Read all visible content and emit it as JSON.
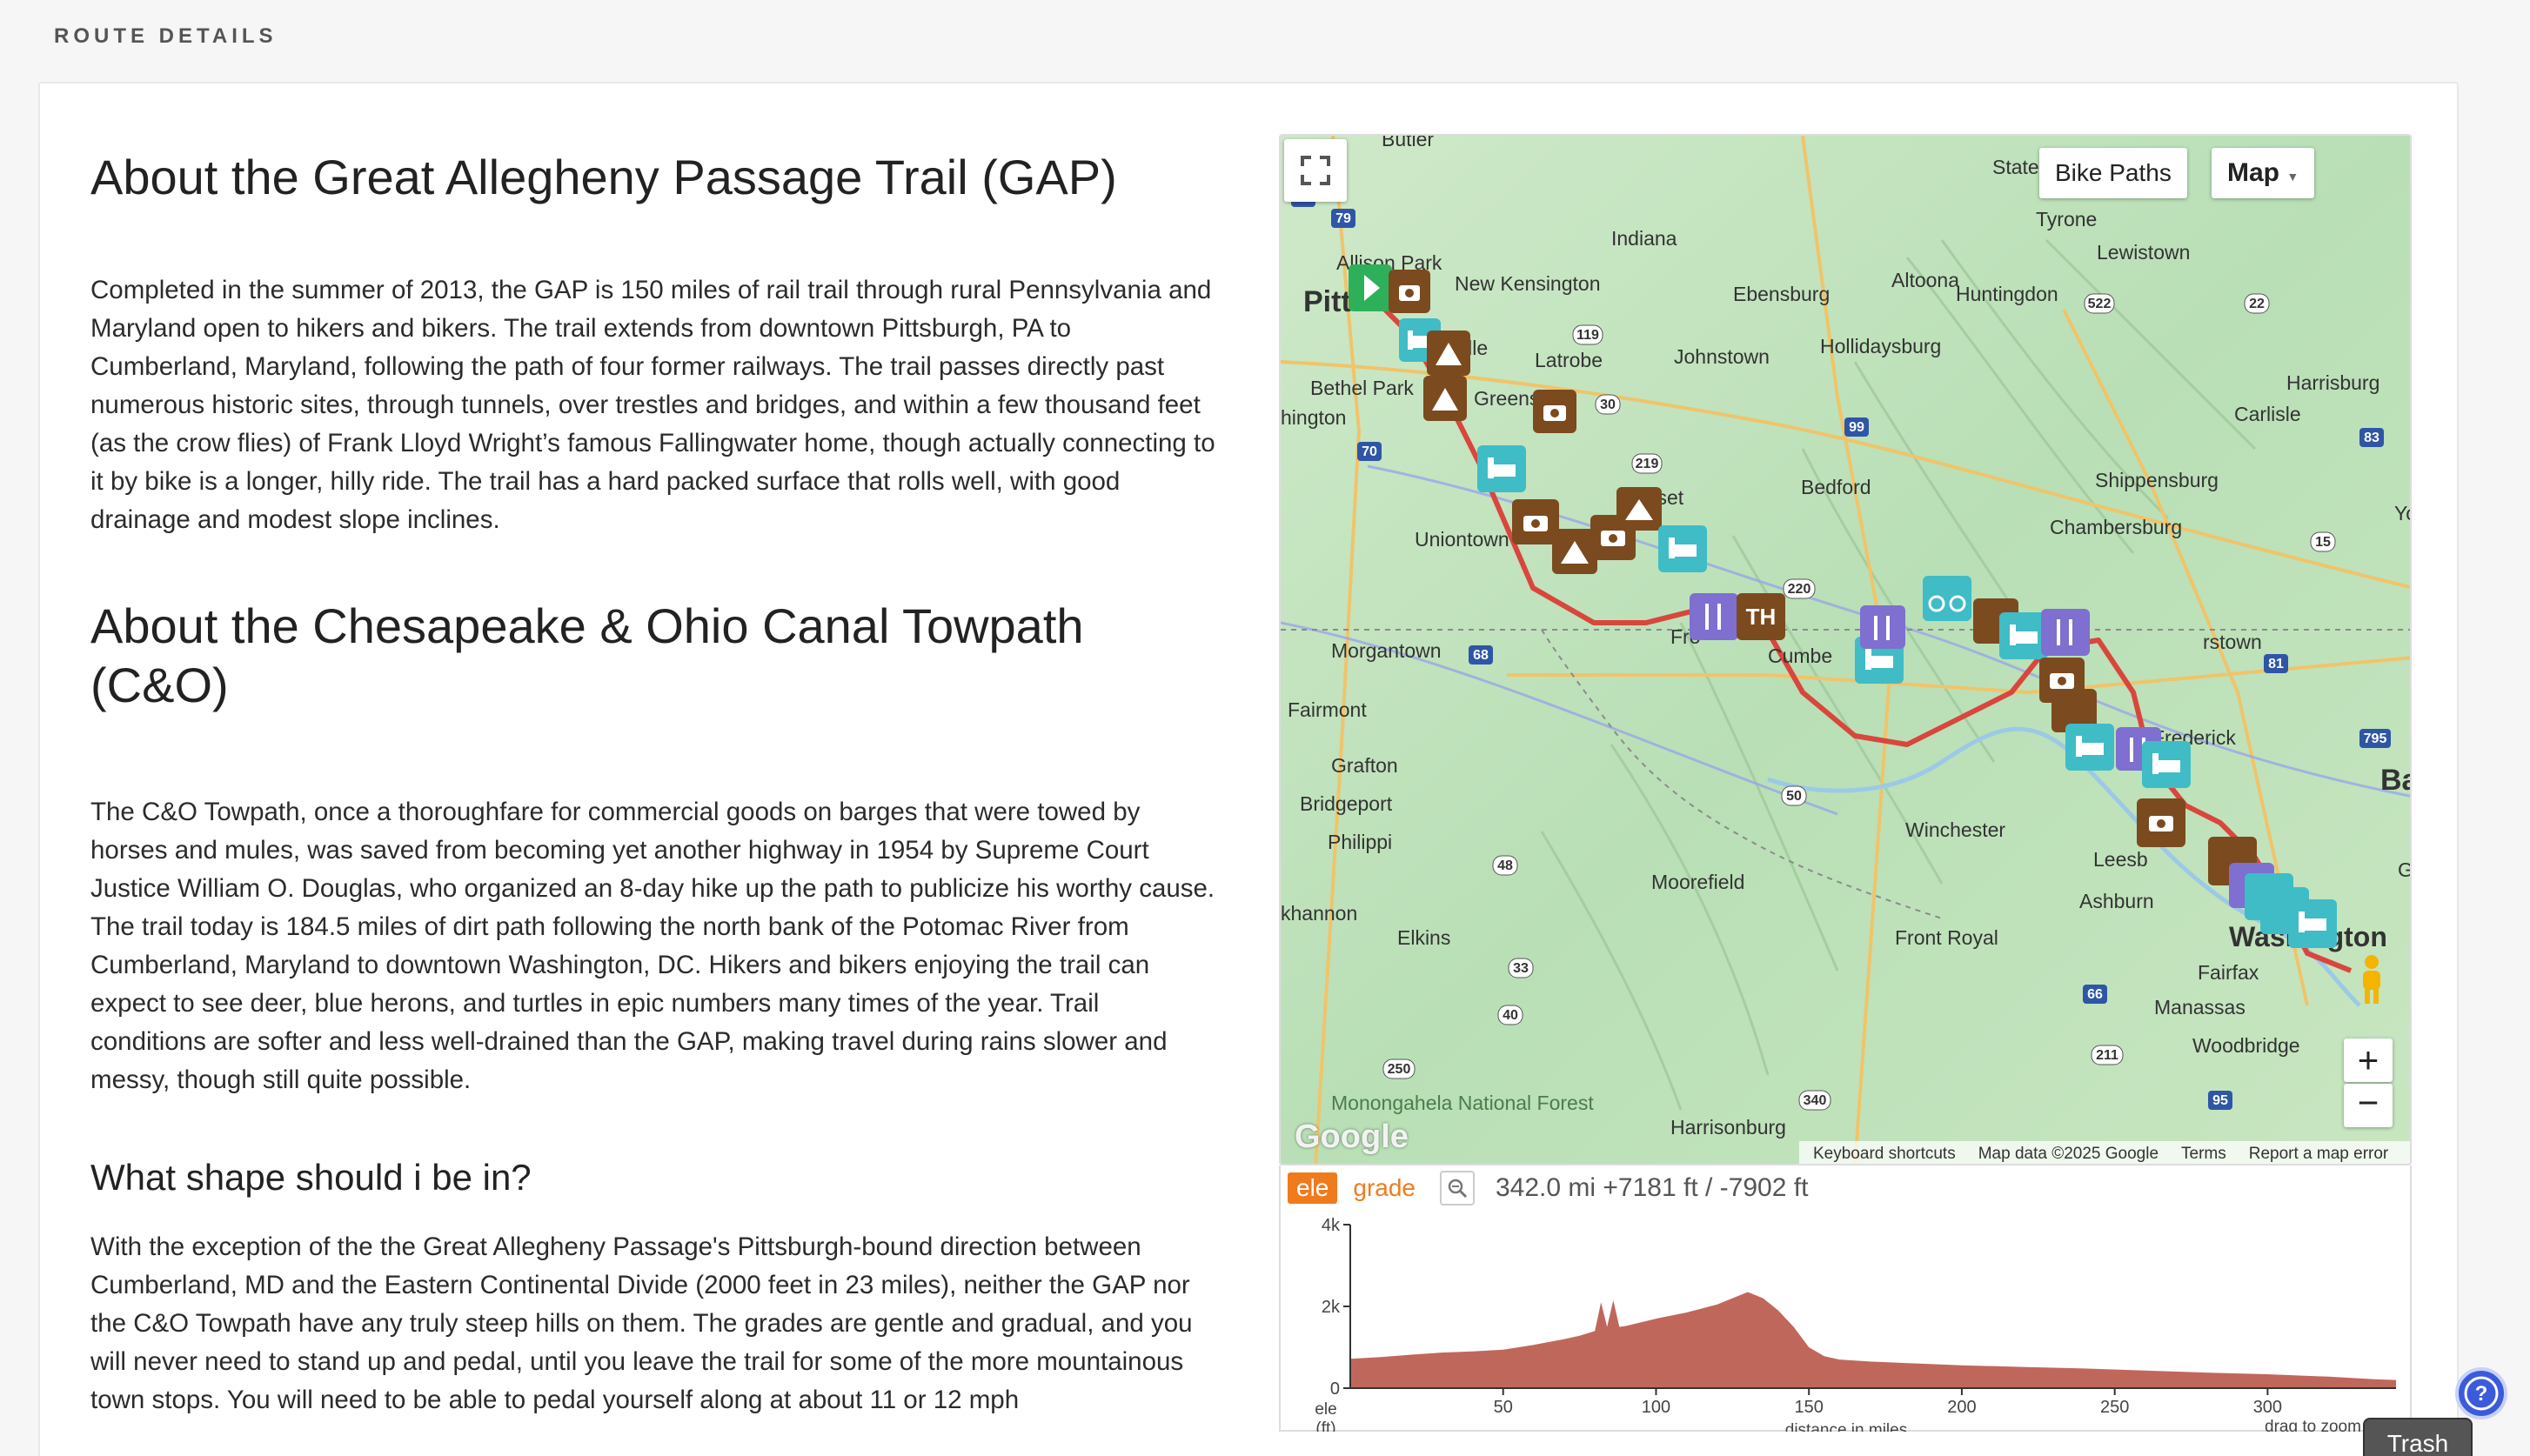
{
  "page": {
    "section_heading": "ROUTE DETAILS"
  },
  "about": {
    "gap_title": "About the Great Allegheny Passage Trail (GAP)",
    "gap_body": "Completed in the summer of 2013, the GAP is 150 miles of rail trail through rural Pennsylvania and Maryland open to hikers and bikers. The trail extends from downtown Pittsburgh, PA to Cumberland, Maryland, following the path of four former railways. The trail passes directly past numerous historic sites, through tunnels, over trestles and bridges, and within a few thousand feet (as the crow flies) of Frank Lloyd Wright’s famous Fallingwater home, though actually connecting to it by bike is a longer, hilly ride. The trail has a hard packed surface that rolls well, with good drainage and modest slope inclines.",
    "co_title": "About the Chesapeake & Ohio Canal Towpath (C&O)",
    "co_body": "The C&O Towpath, once a thoroughfare for commercial goods on barges that were towed by horses and mules, was saved from becoming yet another highway in 1954 by Supreme Court Justice William O. Douglas, who organized an 8-day hike up the path to publicize his worthy cause. The trail today is 184.5 miles of dirt path following the north bank of the Potomac River from Cumberland, Maryland to downtown Washington, DC. Hikers and bikers enjoying the trail can expect to see deer, blue herons, and turtles in epic numbers many times of the year. Trail conditions are softer and less well-drained than the GAP, making travel during rains slower and messy, though still quite possible.",
    "shape_title": "What shape should i be in?",
    "shape_body": "With the exception of the the Great Allegheny Passage's Pittsburgh-bound direction between Cumberland, MD and the Eastern Continental Divide (2000 feet in 23 miles), neither the GAP nor the C&O Towpath have any truly steep hills on them. The grades are gentle and gradual, and you will never need to stand up and pedal, until you leave the trail for some of the more mountainous town stops. You will need to be able to pedal yourself along at about 11 or 12 mph"
  },
  "map": {
    "bike_paths_label": "Bike Paths",
    "map_type_label": "Map",
    "zoom_in": "+",
    "zoom_out": "−",
    "google_logo": "Google",
    "attribution": {
      "shortcuts": "Keyboard shortcuts",
      "data": "Map data ©2025 Google",
      "terms": "Terms",
      "report": "Report a map error"
    },
    "places": [
      "Butler",
      "State",
      "Tyrone",
      "Lewistown",
      "Indiana",
      "Allison Park",
      "New Kensington",
      "Ebensburg",
      "Altoona",
      "Huntingdon",
      "Pitt",
      "Johnstown",
      "Hollidaysburg",
      "Latrobe",
      "Bethel Park",
      "Greens",
      "ille",
      "hington",
      "Harrisburg",
      "Carlisle",
      "Shippensburg",
      "Chambersburg",
      "Bedford",
      "Uniontown",
      "erset",
      "Morgantown",
      "Fairmont",
      "Cumbe",
      "rstown",
      "Fro",
      "Frederick",
      "Grafton",
      "Bridgeport",
      "Philippi",
      "Winchester",
      "Leesb",
      "Moorefield",
      "Ashburn",
      "khannon",
      "Elkins",
      "Front Royal",
      "Washington",
      "Fairfax",
      "Manassas",
      "Woodbridge",
      "Monongahela National Forest",
      "Harrisonburg",
      "Ba",
      "Yo",
      "Gl"
    ],
    "route_shields": [
      "76",
      "79",
      "22",
      "119",
      "30",
      "219",
      "70",
      "99",
      "522",
      "81",
      "15",
      "68",
      "220",
      "50",
      "48",
      "33",
      "250",
      "211",
      "66",
      "95",
      "340",
      "795",
      "83",
      "40"
    ],
    "markers": {
      "start": "start-icon",
      "camera": "camera-icon",
      "camp": "camp-icon",
      "lodging": "bed-icon",
      "food": "fork-knife-icon",
      "trailhead": "TH",
      "bike": "bicycle-icon"
    },
    "colors": {
      "route": "#d9463e",
      "brown_marker": "#7b4a1e",
      "teal_marker": "#3fbcc6",
      "purple_marker": "#7e6fd0",
      "start_marker": "#2eb05a"
    }
  },
  "elevation": {
    "tab_ele": "ele",
    "tab_grade": "grade",
    "stats": "342.0 mi +7181 ft / -7902 ft",
    "y_ticks": [
      "4k",
      "2k",
      "0"
    ],
    "y_unit_1": "ele",
    "y_unit_2": "(ft)",
    "x_ticks": [
      "50",
      "100",
      "150",
      "200",
      "250",
      "300"
    ],
    "x_label": "distance in miles",
    "hint": "drag to zoom in",
    "fill_color": "#c0675c",
    "chart_data": {
      "type": "area",
      "xlabel": "distance in miles",
      "ylabel": "ele (ft)",
      "xlim": [
        0,
        342
      ],
      "ylim": [
        0,
        4000
      ],
      "x": [
        0,
        10,
        20,
        30,
        40,
        50,
        60,
        70,
        75,
        80,
        82,
        84,
        86,
        88,
        90,
        100,
        110,
        120,
        125,
        130,
        135,
        140,
        145,
        150,
        155,
        160,
        170,
        180,
        200,
        220,
        240,
        260,
        280,
        300,
        320,
        335,
        342
      ],
      "y": [
        720,
        760,
        820,
        870,
        900,
        940,
        1060,
        1200,
        1280,
        1400,
        2100,
        1500,
        2150,
        1500,
        1520,
        1700,
        1850,
        2050,
        2200,
        2350,
        2200,
        1900,
        1500,
        1000,
        780,
        700,
        650,
        620,
        560,
        520,
        480,
        430,
        380,
        340,
        280,
        220,
        200
      ]
    }
  },
  "widgets": {
    "trash_label": "Trash"
  }
}
